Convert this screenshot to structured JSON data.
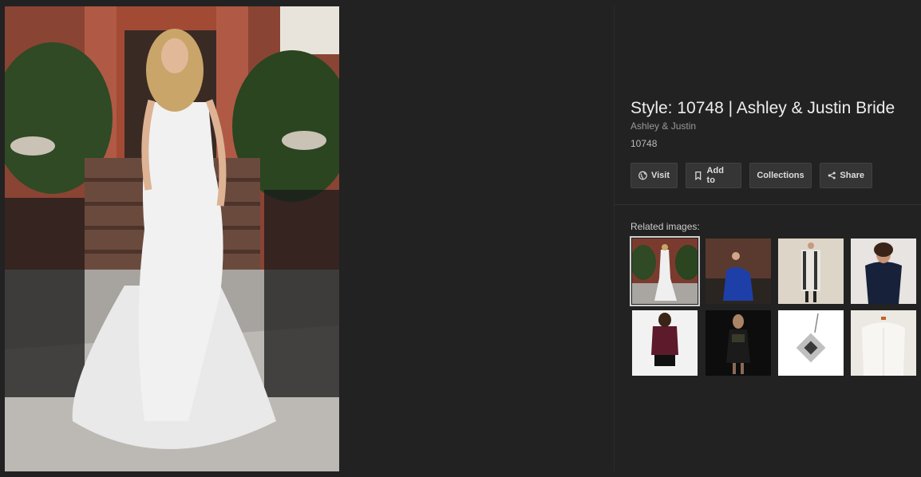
{
  "detail": {
    "title": "Style: 10748 | Ashley & Justin Bride",
    "source": "Ashley & Justin",
    "style_id": "10748"
  },
  "actions": {
    "visit_label": "Visit",
    "add_label": "Add to",
    "collections_label": "Collections",
    "share_label": "Share"
  },
  "related": {
    "label": "Related images:",
    "selected_index": 0
  },
  "colors": {
    "background": "#222222",
    "button_bg": "#353535",
    "title_text": "#eeeeee"
  }
}
